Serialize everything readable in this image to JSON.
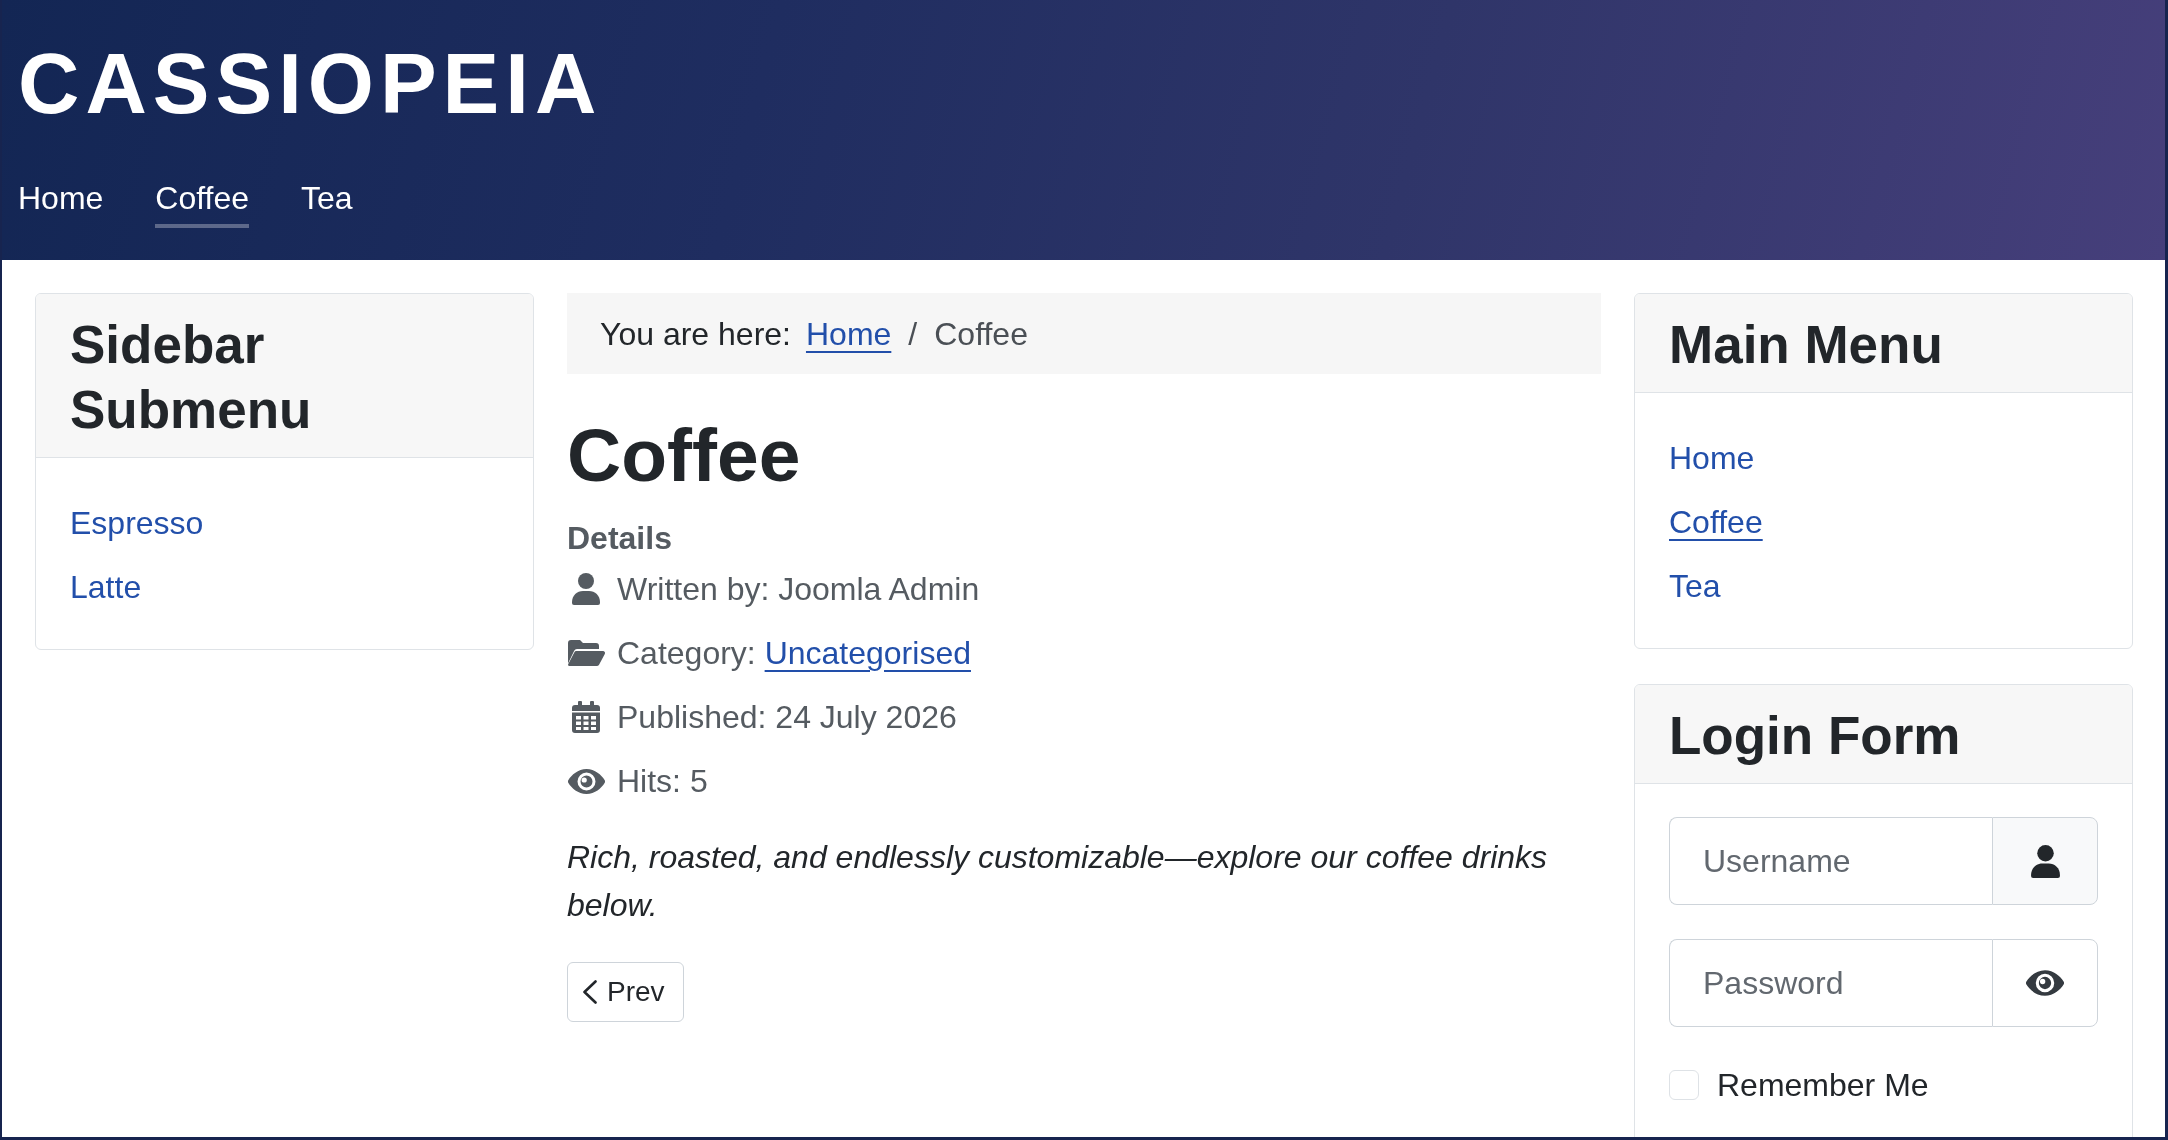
{
  "header": {
    "logo": "CASSIOPEIA",
    "nav": [
      {
        "label": "Home",
        "selected": false
      },
      {
        "label": "Coffee",
        "selected": true
      },
      {
        "label": "Tea",
        "selected": false
      }
    ]
  },
  "sidebar_submenu": {
    "title": "Sidebar Submenu",
    "items": [
      {
        "label": "Espresso",
        "selected": false
      },
      {
        "label": "Latte",
        "selected": false
      }
    ]
  },
  "breadcrumb": {
    "label": "You are here:",
    "separator": "/",
    "items": [
      {
        "kind": "link",
        "label": "Home"
      },
      {
        "kind": "current",
        "label": "Coffee"
      }
    ]
  },
  "article": {
    "title": "Coffee",
    "details": {
      "heading": "Details",
      "items": [
        {
          "kind": "author",
          "text": "Written by: Joomla Admin"
        },
        {
          "kind": "category",
          "text": "Category:",
          "link": "Uncategorised"
        },
        {
          "kind": "published",
          "text": "Published: 24 July 2026"
        },
        {
          "kind": "hits",
          "text": "Hits: 5"
        }
      ]
    },
    "intro": "Rich, roasted, and endlessly customizable—explore our coffee drinks below.",
    "pagination": [
      {
        "kind": "prev",
        "label": "Prev"
      }
    ]
  },
  "main_menu": {
    "title": "Main Menu",
    "items": [
      {
        "label": "Home",
        "selected": false
      },
      {
        "label": "Coffee",
        "selected": true
      },
      {
        "label": "Tea",
        "selected": false
      }
    ]
  },
  "login_form": {
    "title": "Login Form",
    "fields": [
      {
        "kind": "username",
        "placeholder": "Username"
      },
      {
        "kind": "password",
        "placeholder": "Password"
      }
    ],
    "remember": {
      "label": "Remember Me",
      "checked": false
    }
  }
}
